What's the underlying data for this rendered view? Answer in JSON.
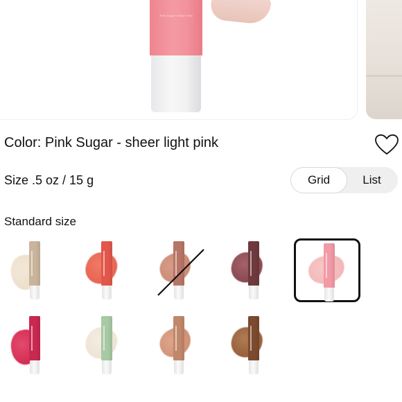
{
  "product": {
    "hero_image": "product-tube-with-finger-swatch",
    "tube_print": "Pink Sugar | Sheer Tint",
    "color_label": "Color: Pink Sugar - sheer light pink",
    "size_label": "Size .5 oz / 15 g",
    "section_label": "Standard size"
  },
  "wishlist_icon": "heart-outline-icon",
  "view_toggle": {
    "options": [
      "Grid",
      "List"
    ],
    "selected": "Grid"
  },
  "swatches": [
    {
      "tube": "#c9b49c",
      "smear": "#eadcc6",
      "smear2": "#f3e8d8",
      "selected": false,
      "unavailable": false
    },
    {
      "tube": "#e3564b",
      "smear": "#e45c4c",
      "smear2": "#ef7a64",
      "selected": false,
      "unavailable": false
    },
    {
      "tube": "#b77566",
      "smear": "#c4836f",
      "smear2": "#d89c86",
      "selected": false,
      "unavailable": true
    },
    {
      "tube": "#6e3a3d",
      "smear": "#7c3e45",
      "smear2": "#a4626a",
      "selected": false,
      "unavailable": false
    },
    {
      "tube": "#f29aa6",
      "smear": "#f1b2b4",
      "smear2": "#f7c7c5",
      "selected": true,
      "unavailable": false
    },
    {
      "tube": "#c9284f",
      "smear": "#d0204a",
      "smear2": "#e24b6d",
      "selected": false,
      "unavailable": false
    },
    {
      "tube": "#a7c9a3",
      "smear": "#ebe0cf",
      "smear2": "#f4ede2",
      "selected": false,
      "unavailable": false
    },
    {
      "tube": "#c1876b",
      "smear": "#c98a6e",
      "smear2": "#dea58a",
      "selected": false,
      "unavailable": false
    },
    {
      "tube": "#7c4a2e",
      "smear": "#8b5532",
      "smear2": "#b07a53",
      "selected": false,
      "unavailable": false
    }
  ]
}
